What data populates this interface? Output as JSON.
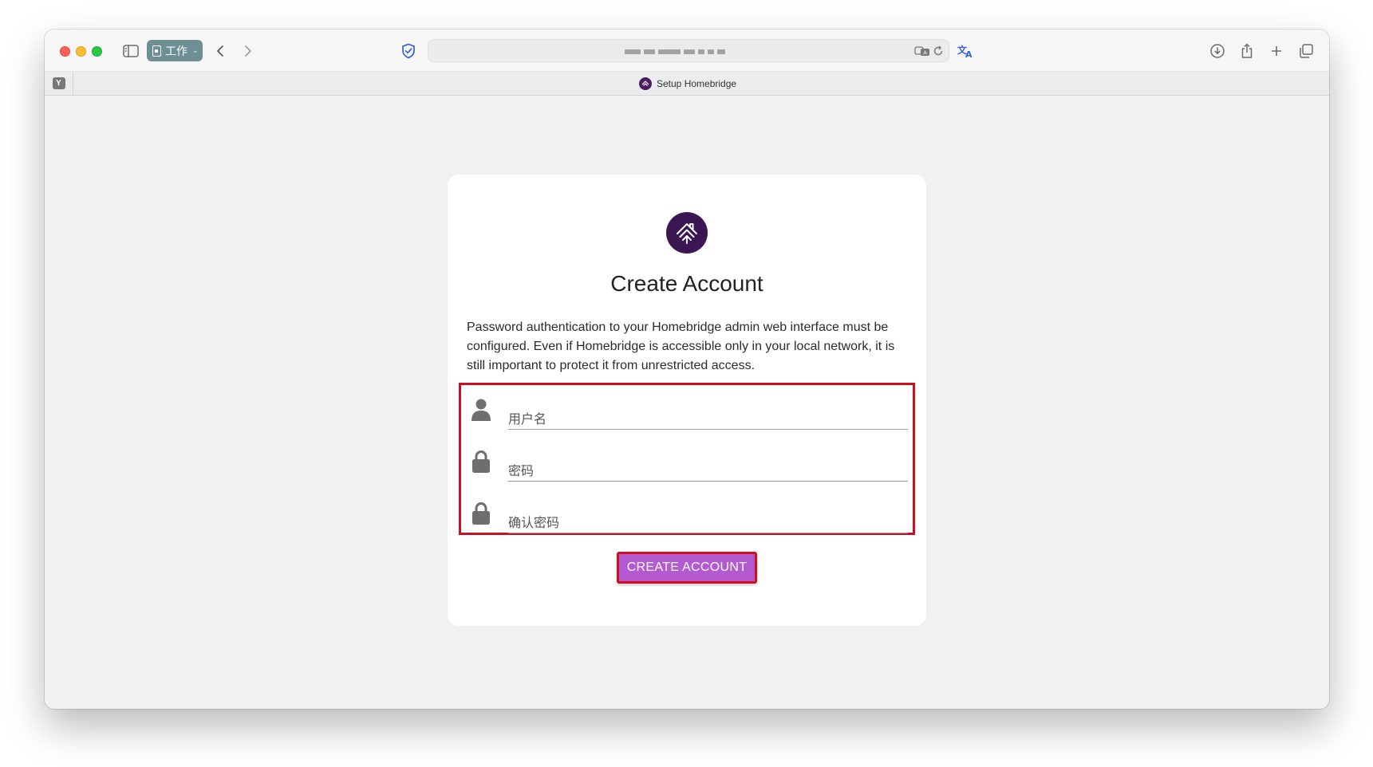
{
  "browser": {
    "tab_group_label": "工作",
    "tab_title": "Setup Homebridge",
    "pinned_tab_letter": "Y",
    "url_display": "obscured",
    "icons": [
      "sidebar-icon",
      "back-icon",
      "forward-icon",
      "privacy-shield-icon",
      "translate-icon",
      "reload-icon",
      "translate-page-icon",
      "downloads-icon",
      "share-icon",
      "new-tab-icon",
      "tab-overview-icon"
    ]
  },
  "page": {
    "logo": "homebridge-logo",
    "title": "Create Account",
    "description": "Password authentication to your Homebridge admin web interface must be configured. Even if Homebridge is accessible only in your local network, it is still important to protect it from unrestricted access.",
    "fields": [
      {
        "name": "username",
        "icon": "user-icon",
        "placeholder": "用户名"
      },
      {
        "name": "password",
        "icon": "lock-icon",
        "placeholder": "密码"
      },
      {
        "name": "confirm-password",
        "icon": "lock-icon",
        "placeholder": "确认密码"
      }
    ],
    "submit_label": "CREATE ACCOUNT"
  },
  "colors": {
    "accent": "#b45ad0",
    "logo_bg": "#3b1652",
    "highlight": "#cc1022"
  }
}
